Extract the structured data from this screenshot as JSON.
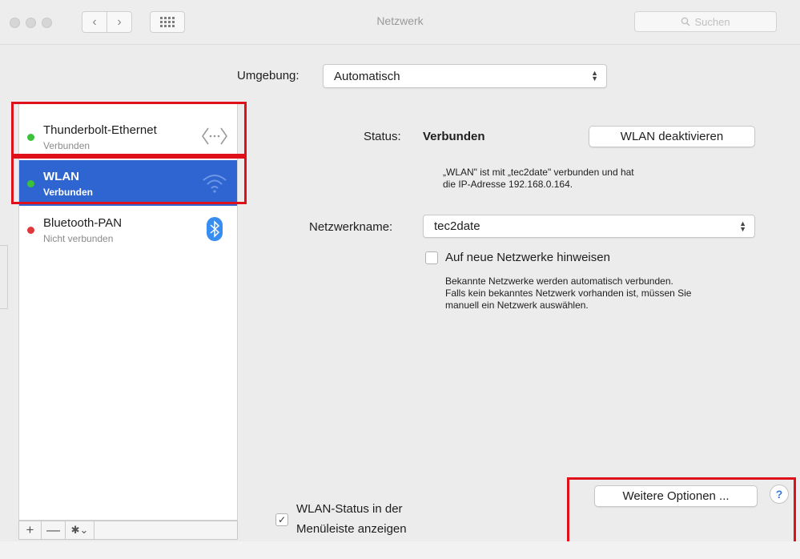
{
  "window": {
    "title": "Netzwerk",
    "search_placeholder": "Suchen",
    "back_glyph": "‹",
    "forward_glyph": "›",
    "icons": [
      "back-chevron-icon",
      "forward-chevron-icon",
      "show-all-grid-icon",
      "search-icon"
    ]
  },
  "location": {
    "label": "Umgebung:",
    "value": "Automatisch"
  },
  "services": [
    {
      "name": "Thunderbolt-Ethernet",
      "status": "Verbunden",
      "dot_color": "#3cc13b",
      "icon": "ethernet-arrows-icon",
      "selected": false
    },
    {
      "name": "WLAN",
      "status": "Verbunden",
      "dot_color": "#3cc13b",
      "icon": "wifi-icon",
      "selected": true
    },
    {
      "name": "Bluetooth-PAN",
      "status": "Nicht verbunden",
      "dot_color": "#e0373a",
      "icon": "bluetooth-icon",
      "selected": false
    }
  ],
  "sidebar_toolbar": {
    "add": "+",
    "remove": "—",
    "actions": "✱⌄"
  },
  "detail": {
    "status_label": "Status:",
    "status_value": "Verbunden",
    "toggle_button": "WLAN deaktivieren",
    "status_desc_line1": "„WLAN\" ist mit „tec2date\" verbunden und hat",
    "status_desc_line2": "die IP-Adresse 192.168.0.164.",
    "network_name_label": "Netzwerkname:",
    "network_name_value": "tec2date",
    "ask_new_label": "Auf neue Netzwerke hinweisen",
    "ask_new_checked": false,
    "ask_desc_line1": "Bekannte Netzwerke werden automatisch verbunden.",
    "ask_desc_line2": "Falls kein bekanntes Netzwerk vorhanden ist, müssen Sie",
    "ask_desc_line3": "manuell ein Netzwerk auswählen."
  },
  "footer": {
    "menubar_label_line1": "WLAN-Status in der",
    "menubar_label_line2": "Menüleiste anzeigen",
    "menubar_checked": true,
    "check_mark": "✓",
    "advanced_button": "Weitere Optionen ...",
    "help": "?"
  },
  "colors": {
    "selection": "#2f65d0",
    "highlight": "#e0101a",
    "connected": "#3cc13b",
    "disconnected": "#e0373a",
    "bluetooth": "#3a8df0"
  }
}
